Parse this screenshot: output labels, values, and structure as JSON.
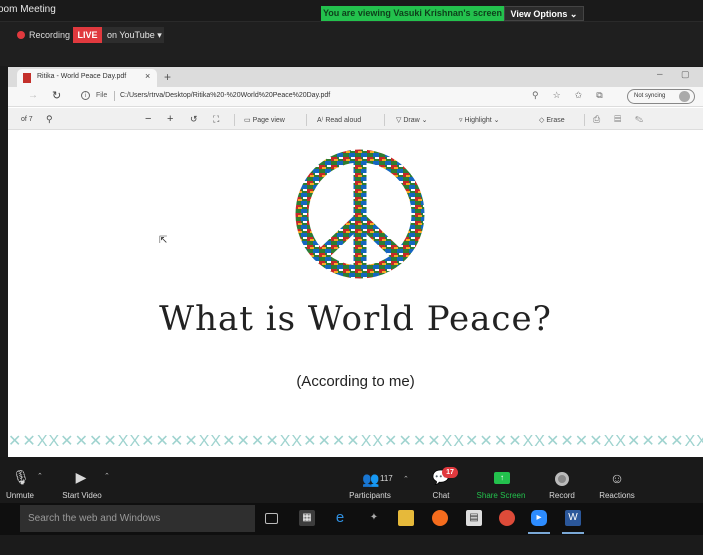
{
  "zoom": {
    "window_title": "oom Meeting",
    "viewing_banner": "You are viewing Vasuki Krishnan's screen",
    "view_options": "View Options",
    "recording_label": "Recording",
    "live_badge": "LIVE",
    "youtube_button": "on YouTube",
    "colors": {
      "accent_green": "#23c14d",
      "live_red": "#e0393e"
    }
  },
  "browser": {
    "tab_title": "Ritika - World Peace Day.pdf",
    "tab_close": "×",
    "new_tab": "+",
    "file_label": "File",
    "url": "C:/Users/rtrva/Desktop/Ritika%20-%20World%20Peace%20Day.pdf",
    "sync_button": "Not syncing",
    "win_minimize": "–",
    "win_maximize": "▢"
  },
  "pdf_toolbar": {
    "page_count": "of 7",
    "page_view": "Page view",
    "read_aloud": "Read aloud",
    "draw": "Draw",
    "highlight": "Highlight",
    "erase": "Erase"
  },
  "document": {
    "heading": "What is World Peace?",
    "subtitle": "(According to me)",
    "border_pattern": "✕✕XX✕✕✕✕XX✕✕✕✕XX✕✕✕✕XX✕✕✕✕XX✕✕✕✕XX✕✕✕✕XX✕✕✕✕XX✕✕✕✕XX✕✕"
  },
  "controls": {
    "unmute": "Unmute",
    "start_video": "Start Video",
    "participants_count": "117",
    "participants": "Participants",
    "chat_badge": "17",
    "chat": "Chat",
    "share_screen": "Share Screen",
    "record": "Record",
    "reactions": "Reactions"
  },
  "taskbar": {
    "search_placeholder": "Search the web and Windows"
  },
  "icons": [
    "pdf-icon",
    "reload-icon",
    "info-icon",
    "search-icon",
    "rotate-icon",
    "fit-page-icon",
    "microphone-muted-icon",
    "video-muted-icon",
    "participants-icon",
    "chat-icon",
    "share-screen-icon",
    "record-icon",
    "reactions-icon",
    "edge-icon",
    "firefox-icon",
    "chrome-icon",
    "zoom-icon",
    "word-icon"
  ]
}
